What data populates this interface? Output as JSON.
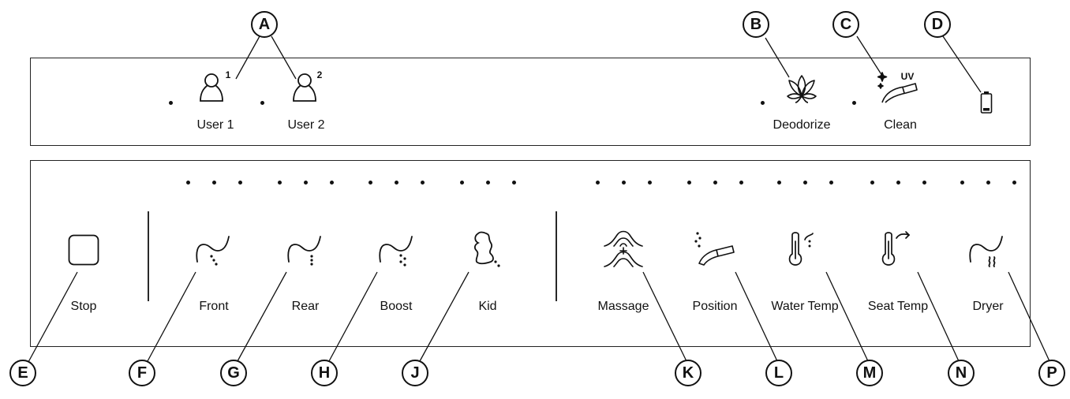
{
  "top_panel": {
    "user1": {
      "label": "User 1",
      "superscript": "1",
      "icon": "user-profile-icon"
    },
    "user2": {
      "label": "User 2",
      "superscript": "2",
      "icon": "user-profile-icon"
    },
    "deodorize": {
      "label": "Deodorize",
      "icon": "lotus-icon"
    },
    "clean": {
      "label": "Clean",
      "icon": "uv-nozzle-icon",
      "badge": "UV"
    },
    "battery": {
      "icon": "battery-icon"
    }
  },
  "bottom_panel": {
    "stop": {
      "label": "Stop",
      "icon": "square-stop-icon"
    },
    "buttons": [
      {
        "key": "front",
        "label": "Front",
        "icon": "front-wash-icon"
      },
      {
        "key": "rear",
        "label": "Rear",
        "icon": "rear-wash-icon"
      },
      {
        "key": "boost",
        "label": "Boost",
        "icon": "boost-wash-icon"
      },
      {
        "key": "kid",
        "label": "Kid",
        "icon": "kid-wash-icon"
      },
      {
        "key": "massage",
        "label": "Massage",
        "icon": "massage-icon"
      },
      {
        "key": "position",
        "label": "Position",
        "icon": "nozzle-position-icon"
      },
      {
        "key": "water_temp",
        "label": "Water Temp",
        "icon": "water-thermometer-icon"
      },
      {
        "key": "seat_temp",
        "label": "Seat Temp",
        "icon": "seat-thermometer-icon"
      },
      {
        "key": "dryer",
        "label": "Dryer",
        "icon": "dryer-icon"
      }
    ]
  },
  "callouts": {
    "A": "A",
    "B": "B",
    "C": "C",
    "D": "D",
    "E": "E",
    "F": "F",
    "G": "G",
    "H": "H",
    "J": "J",
    "K": "K",
    "L": "L",
    "M": "M",
    "N": "N",
    "P": "P"
  }
}
